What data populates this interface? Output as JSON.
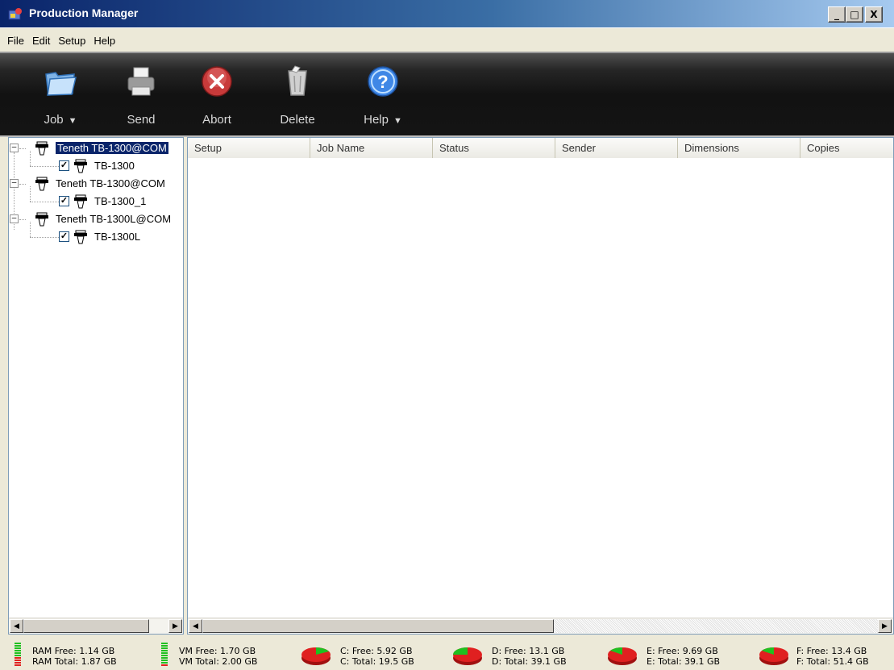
{
  "window": {
    "title": "Production Manager",
    "controls": [
      "_",
      "□",
      "X"
    ]
  },
  "menu": [
    "File",
    "Edit",
    "Setup",
    "Help"
  ],
  "toolbar": {
    "buttons": [
      {
        "label": "Job",
        "dropdown": "▼",
        "icon": "folder-icon"
      },
      {
        "label": "Send",
        "icon": "printer-icon"
      },
      {
        "label": "Abort",
        "icon": "abort-icon"
      },
      {
        "label": "Delete",
        "icon": "trash-icon"
      },
      {
        "label": "Help",
        "dropdown": "▼",
        "icon": "help-icon"
      }
    ]
  },
  "tree": {
    "nodes": [
      {
        "label": "Teneth TB-1300@COM",
        "selected": true,
        "children": [
          {
            "label": "TB-1300",
            "checked": "✓"
          }
        ]
      },
      {
        "label": "Teneth TB-1300@COM",
        "selected": false,
        "children": [
          {
            "label": "TB-1300_1",
            "checked": "✓"
          }
        ]
      },
      {
        "label": "Teneth TB-1300L@COM",
        "selected": false,
        "children": [
          {
            "label": "TB-1300L",
            "checked": "✓"
          }
        ]
      }
    ]
  },
  "job_list": {
    "columns": [
      "Setup",
      "Job Name",
      "Status",
      "Sender",
      "Dimensions",
      "Copies"
    ],
    "rows": []
  },
  "scroll": {
    "left_arrow": "◀",
    "right_arrow": "▶"
  },
  "status": {
    "ram_free": "RAM Free: 1.14 GB",
    "ram_total": "RAM Total: 1.87 GB",
    "vm_free": "VM Free: 1.70 GB",
    "vm_total": "VM Total: 2.00 GB",
    "c_free": "C: Free: 5.92 GB",
    "c_total": "C: Total: 19.5 GB",
    "d_free": "D: Free: 13.1 GB",
    "d_total": "D: Total: 39.1 GB",
    "e_free": "E: Free: 9.69 GB",
    "e_total": "E: Total: 39.1 GB",
    "f_free": "F: Free: 13.4 GB",
    "f_total": "F: Total: 51.4 GB"
  },
  "colors": {
    "used": "#e02020",
    "free": "#20c020",
    "selection": "#0a246a"
  }
}
